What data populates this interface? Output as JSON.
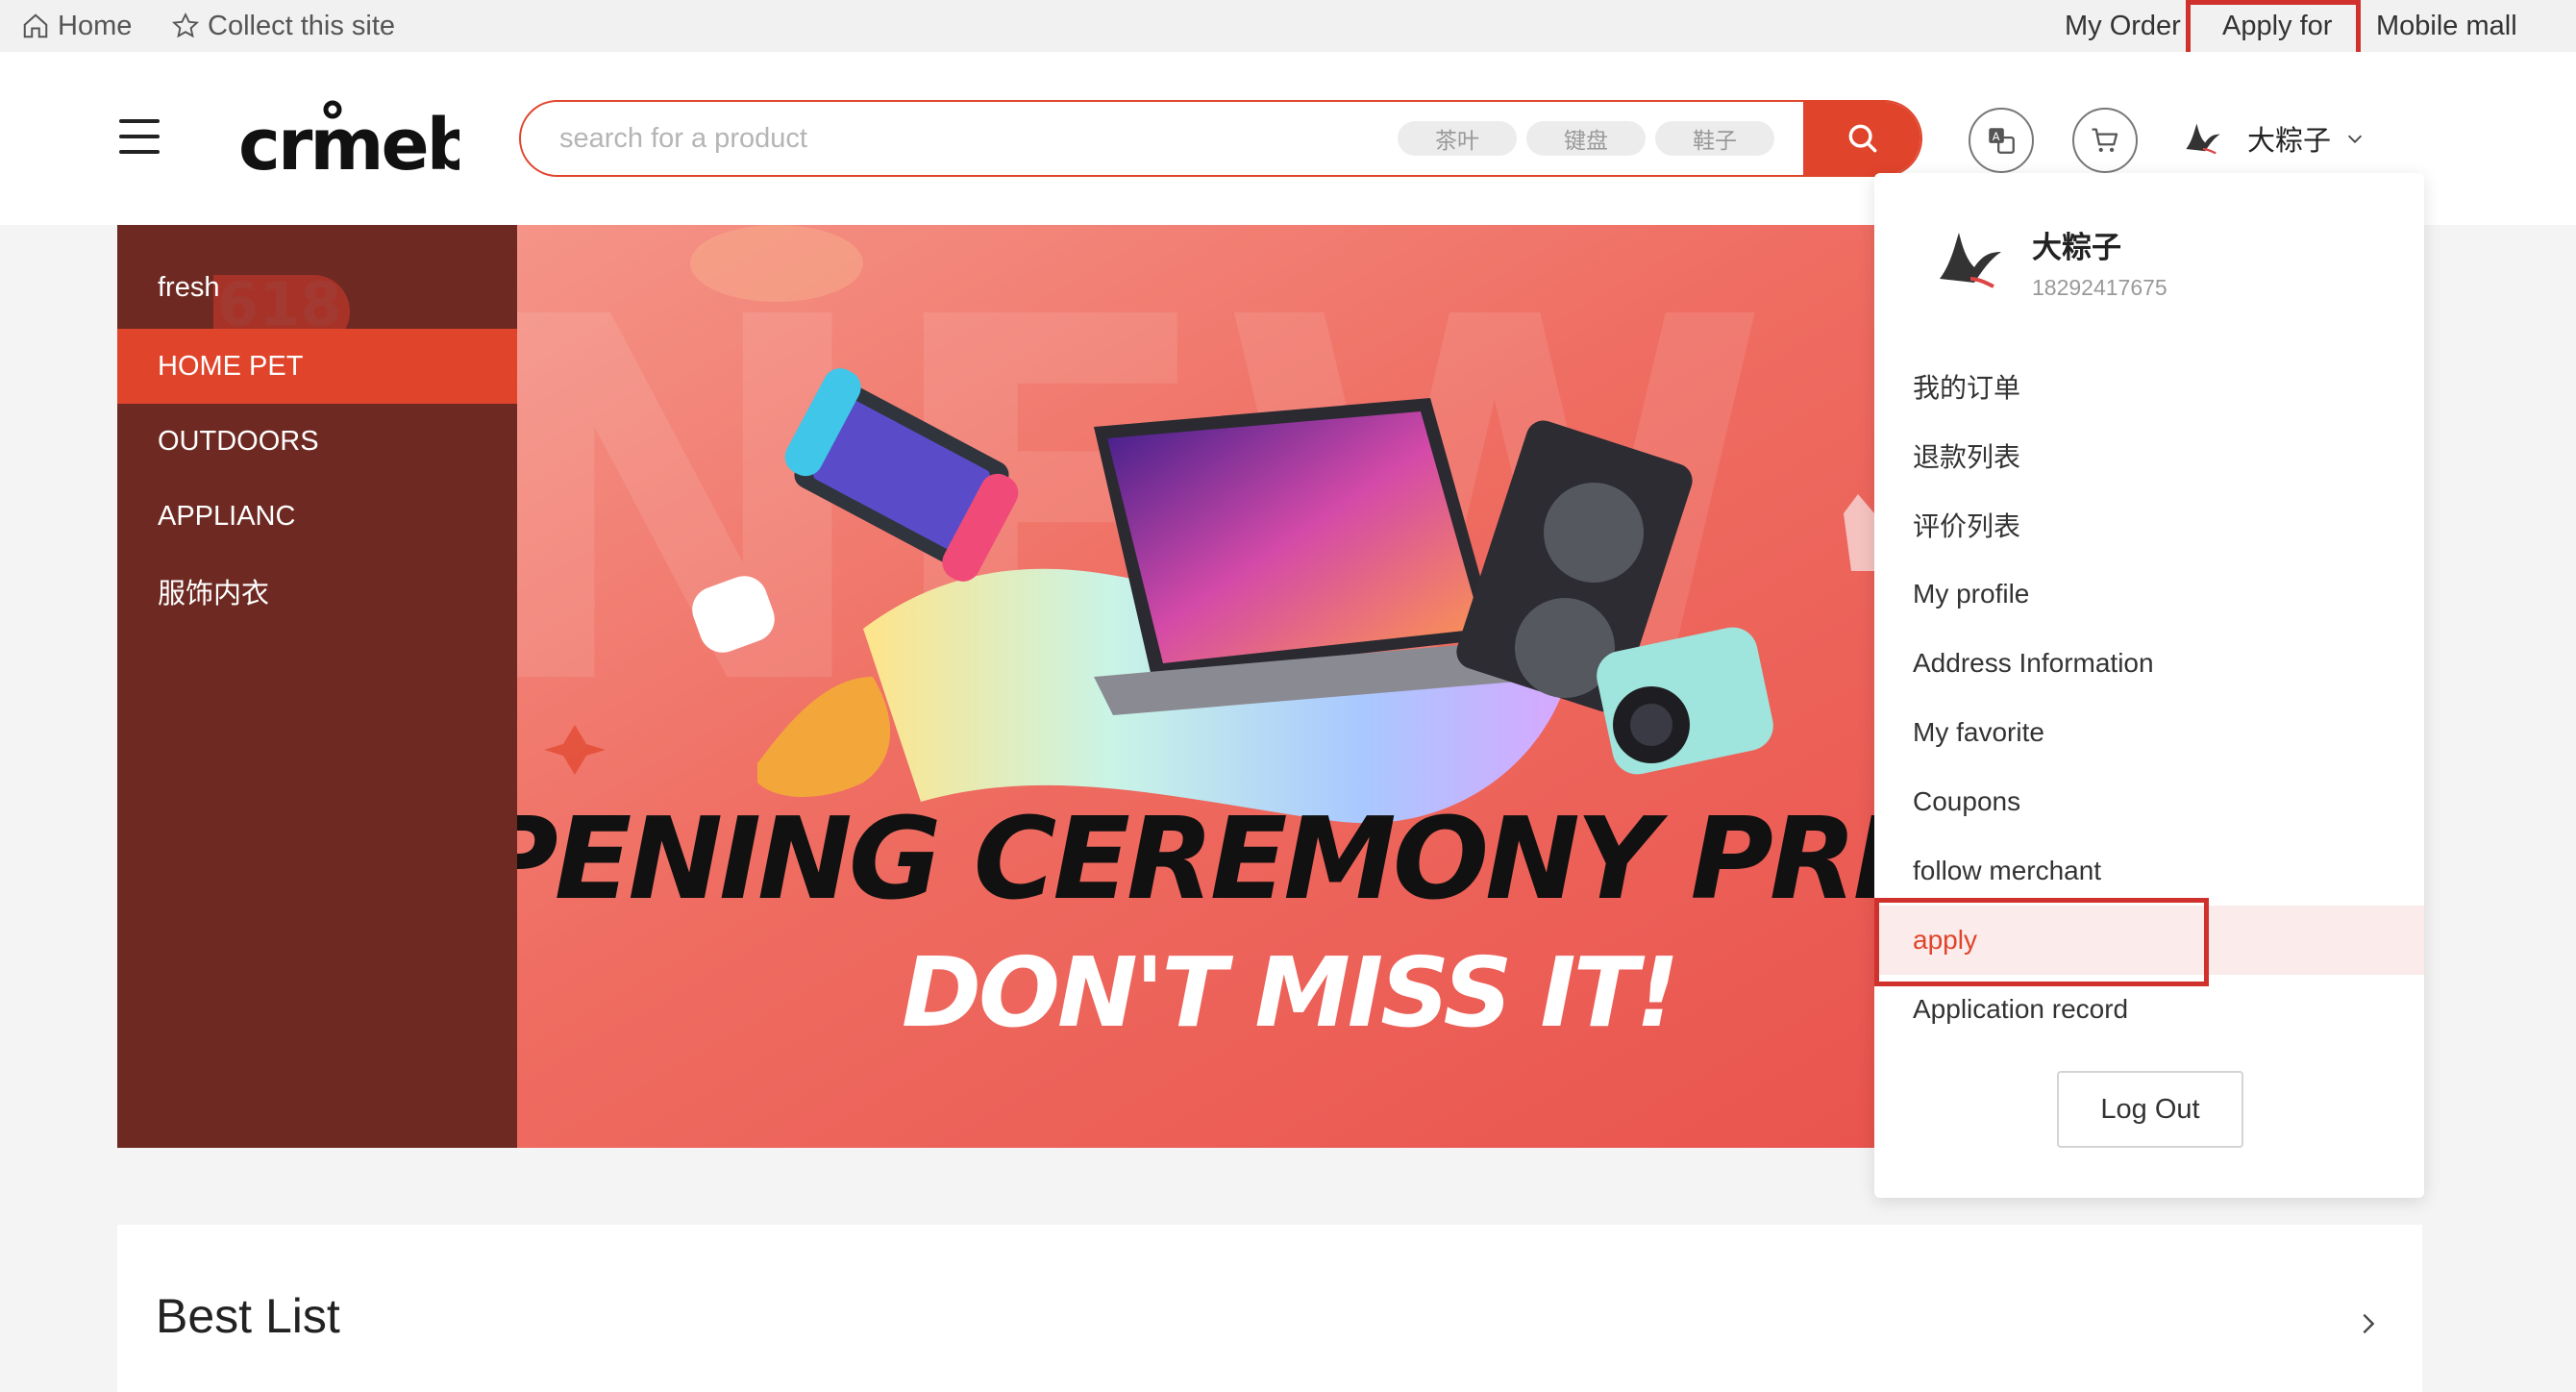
{
  "topbar": {
    "home": "Home",
    "collect": "Collect this site",
    "my_order": "My Order",
    "apply_for": "Apply for",
    "mobile_mall": "Mobile mall"
  },
  "header": {
    "logo_text": "crmeb",
    "search": {
      "placeholder": "search for a product",
      "tags": [
        "茶叶",
        "键盘",
        "鞋子"
      ]
    },
    "user": {
      "name": "大粽子"
    }
  },
  "categories": [
    "fresh",
    "HOME PET",
    "OUTDOORS",
    "APPLIANC",
    "服饰内衣"
  ],
  "active_category": "HOME PET",
  "banner": {
    "badge": "618",
    "headline": "OPENING CEREMONY PRE-",
    "subline": "DON'T MISS IT!"
  },
  "dropdown": {
    "name": "大粽子",
    "phone": "18292417675",
    "items": [
      "我的订单",
      "退款列表",
      "评价列表",
      "My profile",
      "Address Information",
      "My favorite",
      "Coupons",
      "follow merchant",
      "apply",
      "Application record"
    ],
    "active_item": "apply",
    "logout": "Log Out"
  },
  "best_list": {
    "title": "Best List"
  },
  "colors": {
    "accent": "#e0442b",
    "highlight_box": "#d0312d",
    "category_bg": "#6e2a22"
  }
}
